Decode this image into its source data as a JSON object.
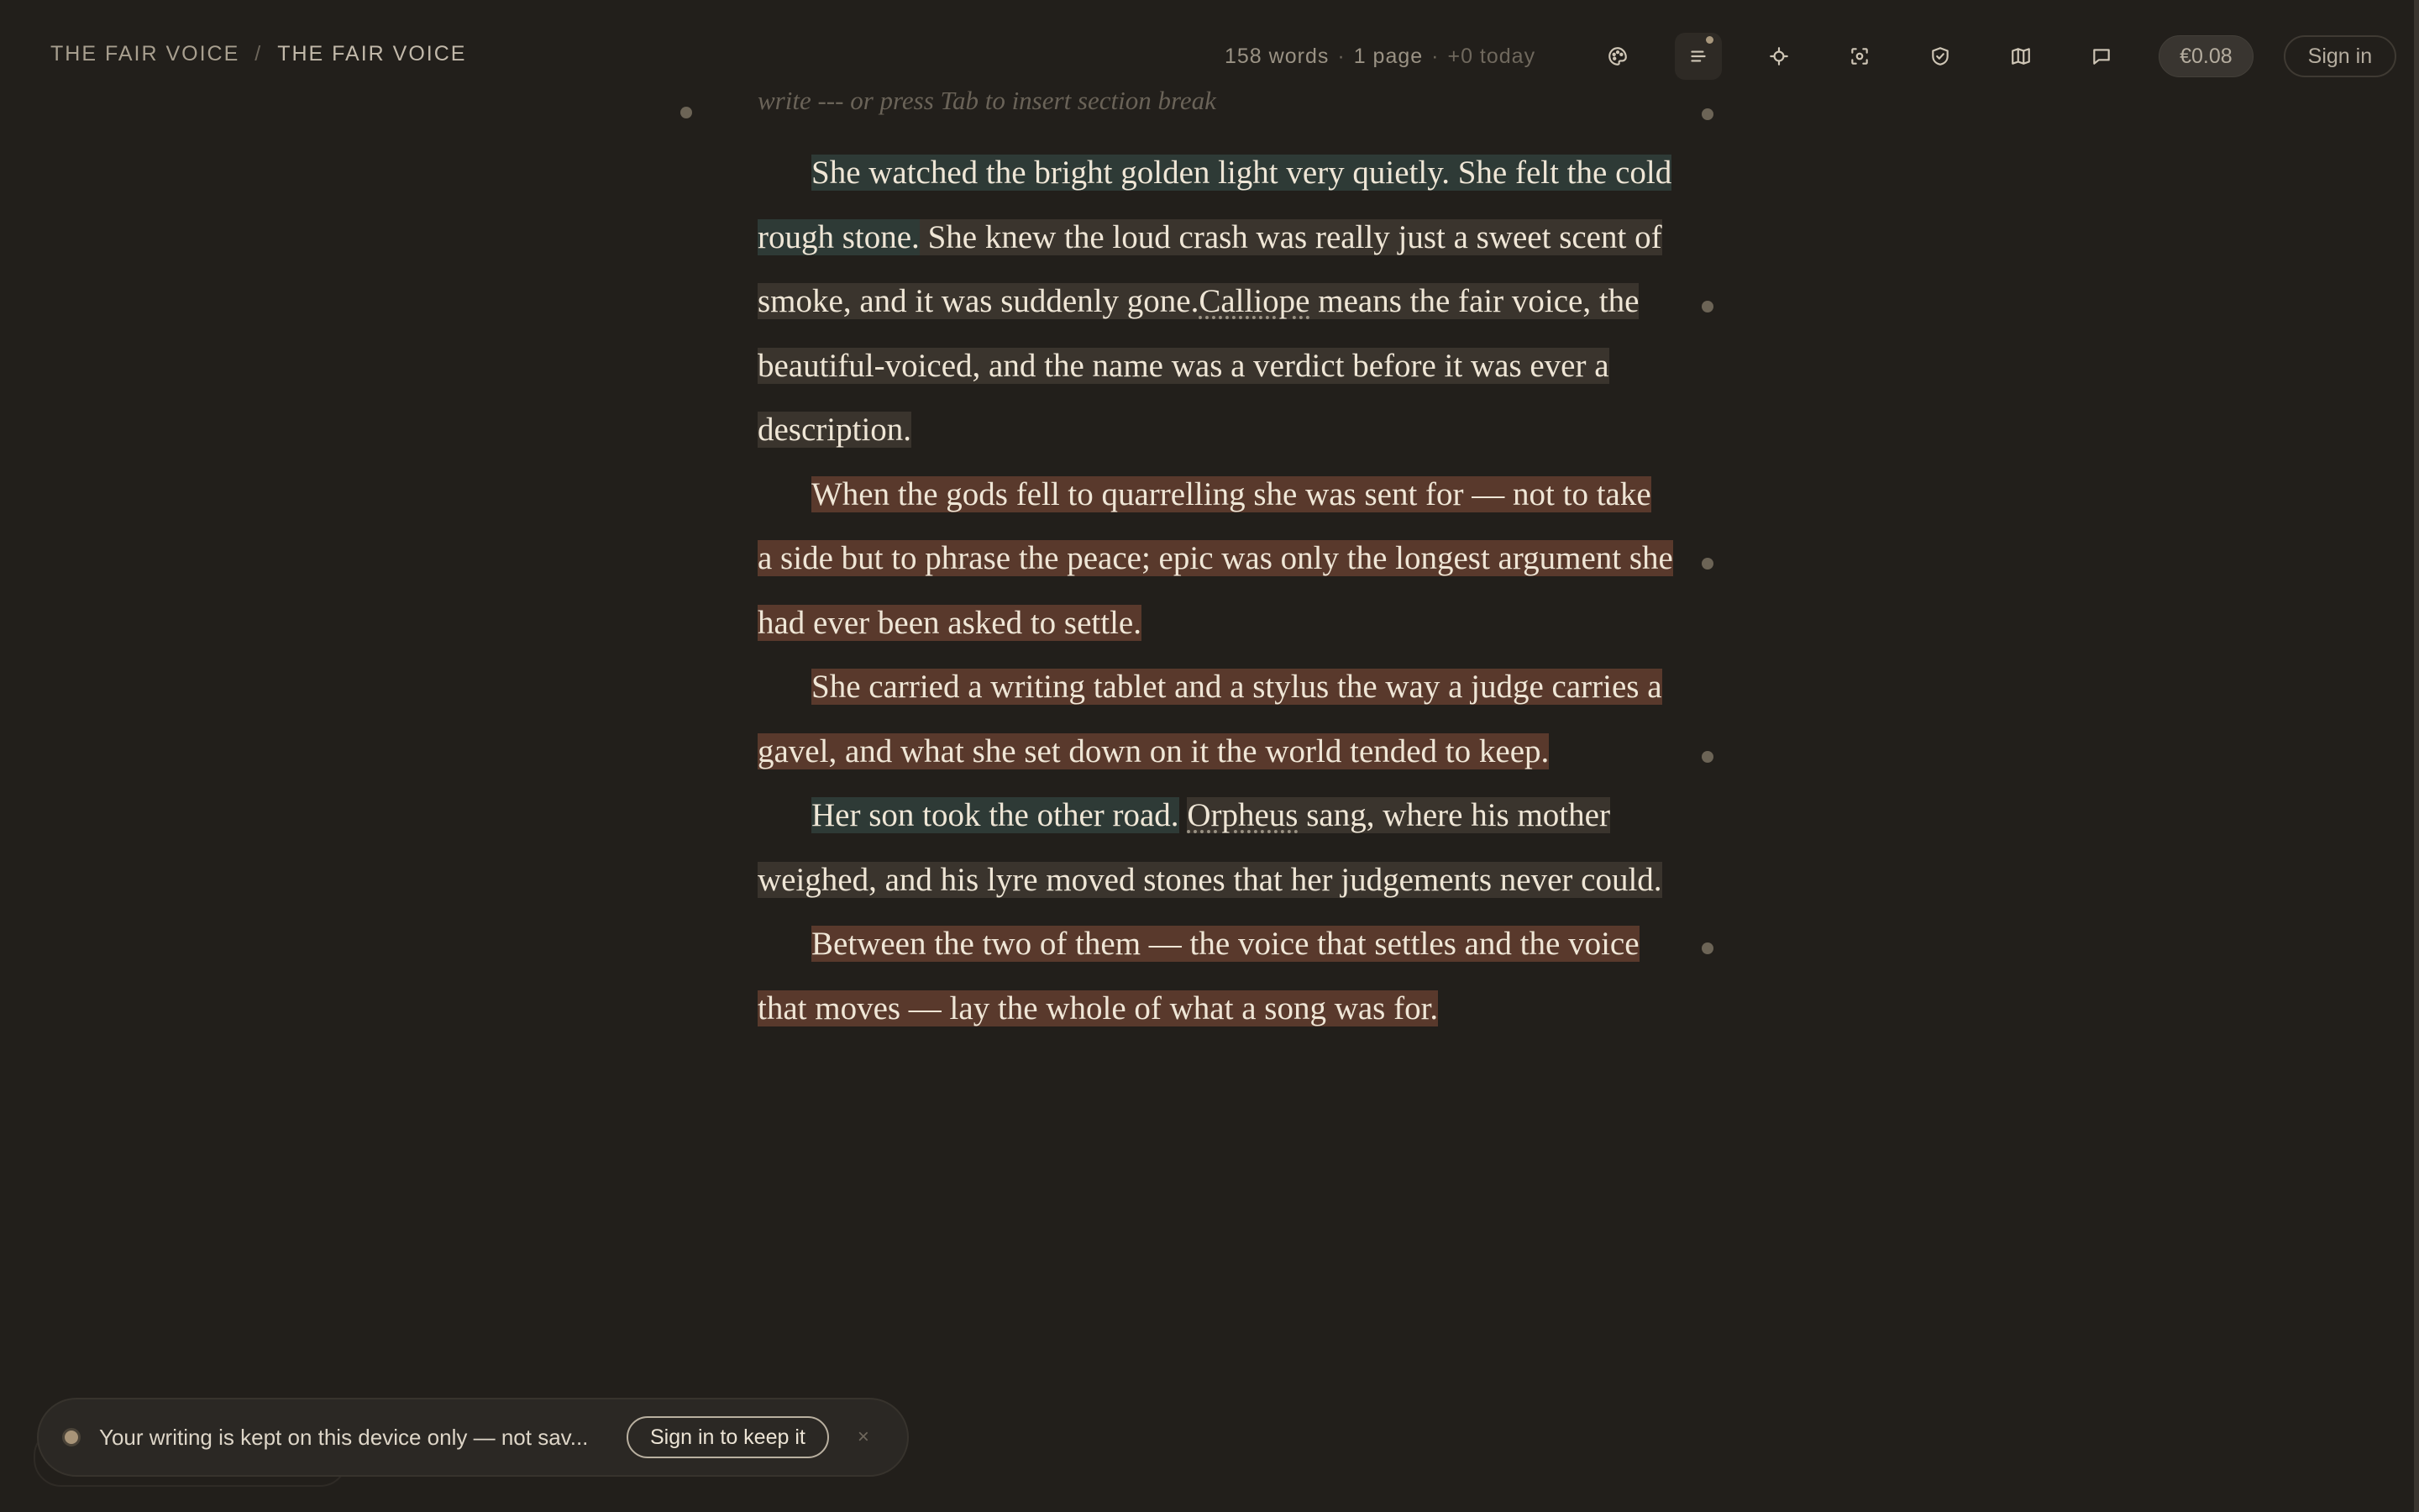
{
  "breadcrumb": {
    "project": "THE FAIR VOICE",
    "separator": "/",
    "document": "THE FAIR VOICE"
  },
  "stats": {
    "words": "158 words",
    "pages": "1 page",
    "today": "+0 today"
  },
  "toolbar": {
    "icons": [
      "palette-icon",
      "outline-icon",
      "focus-target-icon",
      "screenshot-frame-icon",
      "shield-check-icon",
      "map-icon",
      "comment-icon"
    ],
    "price": "€0.08",
    "signin": "Sign in"
  },
  "editor": {
    "hint": "write --- or press Tab to insert section break",
    "p1": {
      "s1": "She watched the bright golden light very quietly. She felt the cold rough stone.",
      "s2": " She knew the loud crash was really just a sweet scent of smoke, and it was suddenly gone.",
      "s3_link": "Calliope",
      "s4": " means the fair voice, the beautiful-voiced, and the name was a verdict before it was ever a description."
    },
    "p2": "When the gods fell to quarrelling she was sent for — not to take a side but to phrase the peace; epic was only the longest argument she had ever been asked to settle.",
    "p3": "She carried a writing tablet and a stylus the way a judge carries a gavel, and what she set down on it the world tended to keep.",
    "p4": {
      "s1": "Her son took the other road.",
      "s2_link": "Orpheus",
      "s3": " sang, where his mother weighed, and his lyre moved stones that her judgements never could."
    },
    "p5": "Between the two of them — the voice that settles and the voice that moves — lay the whole of what a song was for."
  },
  "toast": {
    "message": "Your writing is kept on this device only — not sav...",
    "button": "Sign in to keep it",
    "close": "×"
  },
  "colors": {
    "background": "#221f1b",
    "highlight_teal": "#2e3a36",
    "highlight_rust": "#59392c",
    "highlight_neutral": "#3a342d"
  }
}
